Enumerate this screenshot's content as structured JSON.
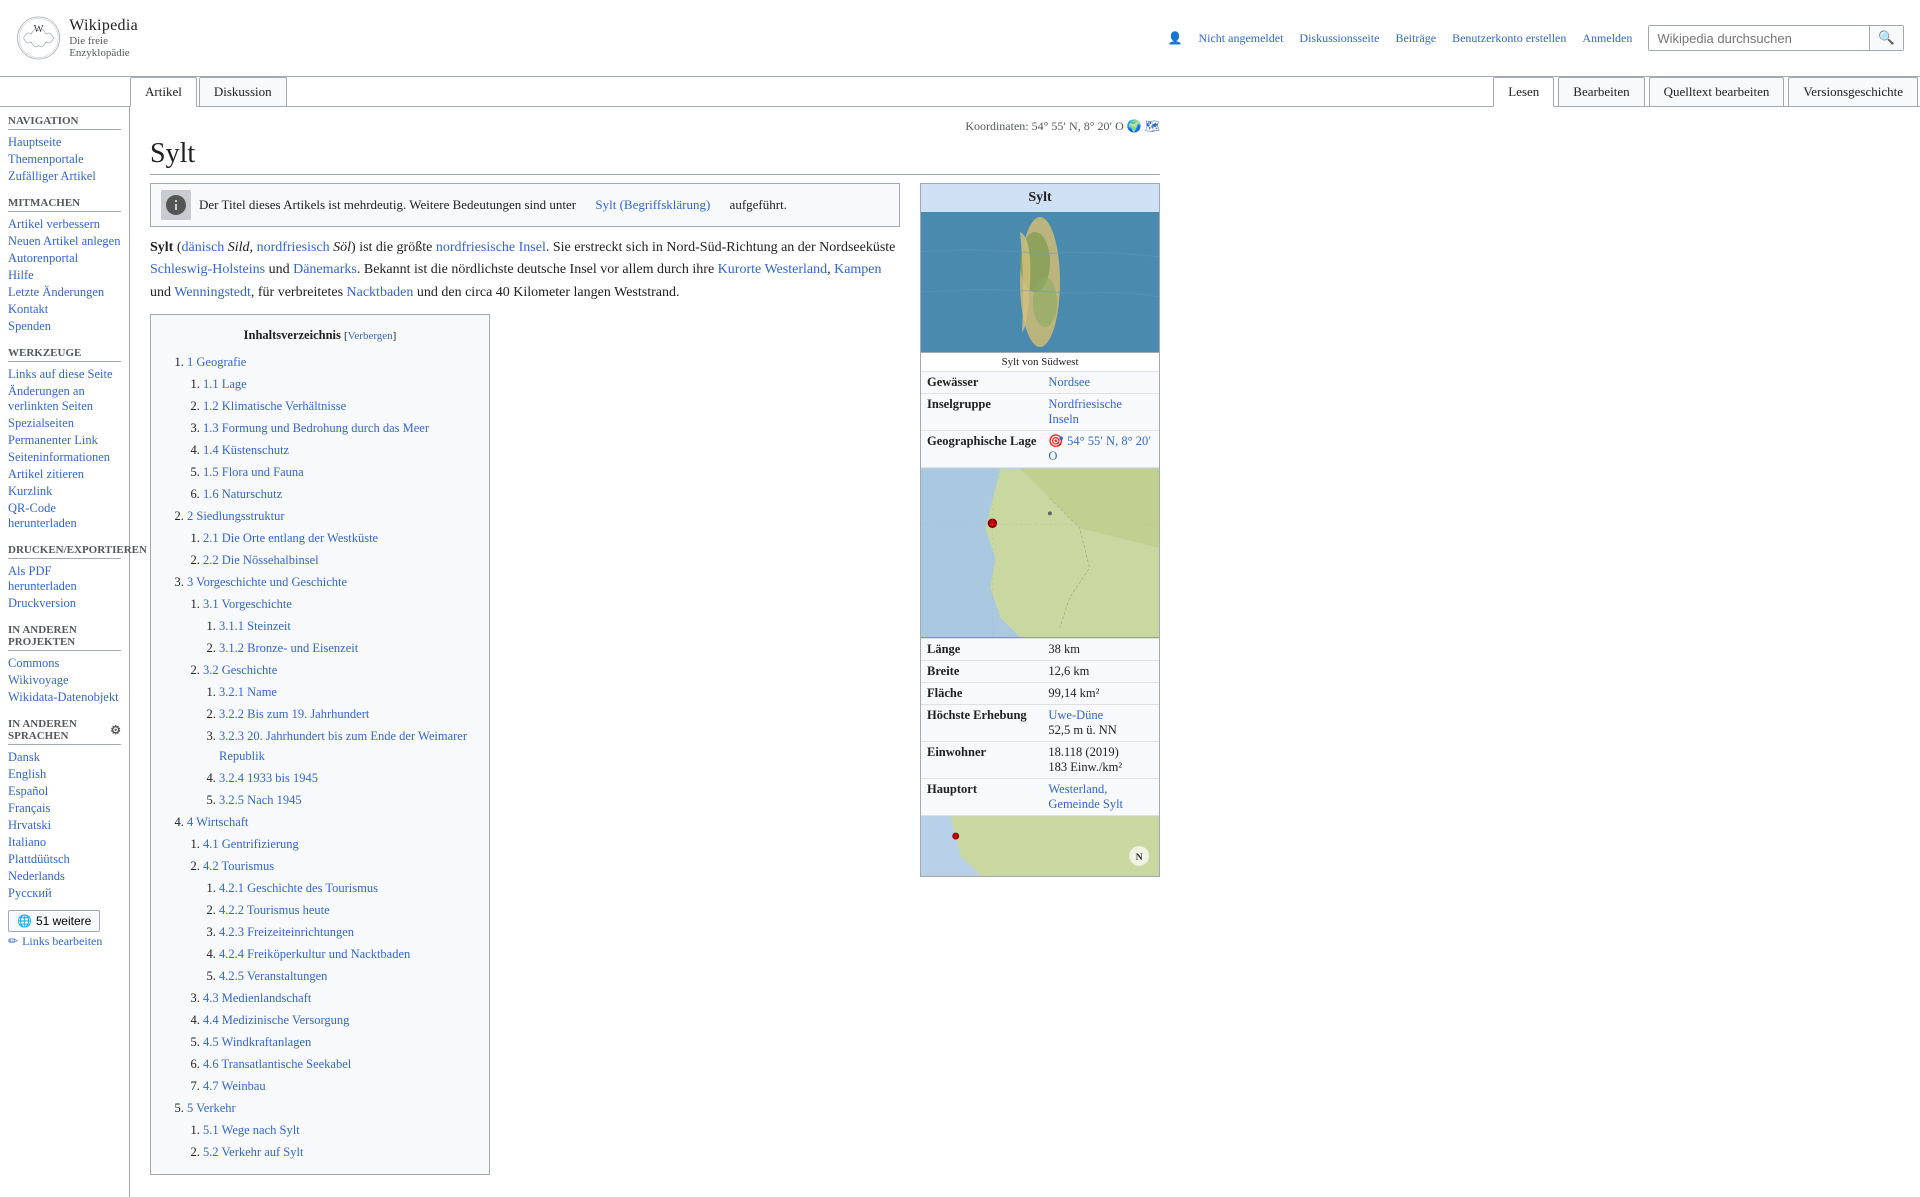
{
  "header": {
    "logo_title": "Wikipedia",
    "logo_subtitle": "Die freie Enzyklopädie",
    "top_nav": {
      "not_logged_in": "Nicht angemeldet",
      "discussion": "Diskussionsseite",
      "contributions": "Beiträge",
      "create_account": "Benutzerkonto erstellen",
      "login": "Anmelden"
    },
    "search_placeholder": "Wikipedia durchsuchen"
  },
  "tabs": {
    "article": "Artikel",
    "discussion": "Diskussion",
    "read": "Lesen",
    "edit": "Bearbeiten",
    "edit_source": "Quelltext bearbeiten",
    "history": "Versionsgeschichte"
  },
  "sidebar": {
    "navigation_title": "Navigation",
    "navigation_items": [
      {
        "label": "Hauptseite",
        "href": "#"
      },
      {
        "label": "Themenportale",
        "href": "#"
      },
      {
        "label": "Zufälliger Artikel",
        "href": "#"
      }
    ],
    "participate_title": "Mitmachen",
    "participate_items": [
      {
        "label": "Artikel verbessern",
        "href": "#"
      },
      {
        "label": "Neuen Artikel anlegen",
        "href": "#"
      },
      {
        "label": "Autorenportal",
        "href": "#"
      },
      {
        "label": "Hilfe",
        "href": "#"
      },
      {
        "label": "Letzte Änderungen",
        "href": "#"
      },
      {
        "label": "Kontakt",
        "href": "#"
      },
      {
        "label": "Spenden",
        "href": "#"
      }
    ],
    "tools_title": "Werkzeuge",
    "tools_items": [
      {
        "label": "Links auf diese Seite",
        "href": "#"
      },
      {
        "label": "Änderungen an verlinkten Seiten",
        "href": "#"
      },
      {
        "label": "Spezialseiten",
        "href": "#"
      },
      {
        "label": "Permanenter Link",
        "href": "#"
      },
      {
        "label": "Seiteninformationen",
        "href": "#"
      },
      {
        "label": "Artikel zitieren",
        "href": "#"
      },
      {
        "label": "Kurzlink",
        "href": "#"
      },
      {
        "label": "QR-Code herunterladen",
        "href": "#"
      }
    ],
    "print_title": "Drucken/exportieren",
    "print_items": [
      {
        "label": "Als PDF herunterladen",
        "href": "#"
      },
      {
        "label": "Druckversion",
        "href": "#"
      }
    ],
    "other_projects_title": "In anderen Projekten",
    "other_projects_items": [
      {
        "label": "Commons",
        "href": "#"
      },
      {
        "label": "Wikivoyage",
        "href": "#"
      },
      {
        "label": "Wikidata-Datenobjekt",
        "href": "#"
      }
    ],
    "languages_title": "In anderen Sprachen",
    "languages": [
      {
        "label": "Dansk",
        "href": "#"
      },
      {
        "label": "English",
        "href": "#"
      },
      {
        "label": "Español",
        "href": "#"
      },
      {
        "label": "Français",
        "href": "#"
      },
      {
        "label": "Hrvatski",
        "href": "#"
      },
      {
        "label": "Italiano",
        "href": "#"
      },
      {
        "label": "Plattdüütsch",
        "href": "#"
      },
      {
        "label": "Nederlands",
        "href": "#"
      },
      {
        "label": "Русский",
        "href": "#"
      }
    ],
    "more_langs_label": "51 weitere",
    "edit_links_label": "Links bearbeiten"
  },
  "page": {
    "title": "Sylt",
    "coords": "Koordinaten: 54° 55′ N, 8° 20′ O",
    "disambig_text": "Der Titel dieses Artikels ist mehrdeutig. Weitere Bedeutungen sind unter",
    "disambig_link": "Sylt (Begriffsklärung)",
    "disambig_suffix": "aufgeführt.",
    "intro": "Sylt (dänisch Sild, nordfriesisch Söl) ist die größte nordfriesische Insel. Sie erstreckt sich in Nord-Süd-Richtung an der Nordseeküste Schleswig-Holsteins und Dänemarks. Bekannt ist die nördlichste deutsche Insel vor allem durch ihre Kurorte Westerland, Kampen und Wenningstedt, für verbreitetes Nacktbaden und den circa 40 Kilometer langen Weststrand."
  },
  "toc": {
    "title": "Inhaltsverzeichnis",
    "hide_label": "Verbergen",
    "items": [
      {
        "num": "1",
        "label": "Geografie",
        "href": "#",
        "sub": [
          {
            "num": "1.1",
            "label": "Lage",
            "href": "#"
          },
          {
            "num": "1.2",
            "label": "Klimatische Verhältnisse",
            "href": "#"
          },
          {
            "num": "1.3",
            "label": "Formung und Bedrohung durch das Meer",
            "href": "#"
          },
          {
            "num": "1.4",
            "label": "Küstenschutz",
            "href": "#"
          },
          {
            "num": "1.5",
            "label": "Flora und Fauna",
            "href": "#"
          },
          {
            "num": "1.6",
            "label": "Naturschutz",
            "href": "#"
          }
        ]
      },
      {
        "num": "2",
        "label": "Siedlungsstruktur",
        "href": "#",
        "sub": [
          {
            "num": "2.1",
            "label": "Die Orte entlang der Westküste",
            "href": "#"
          },
          {
            "num": "2.2",
            "label": "Die Nössehalbinsel",
            "href": "#"
          }
        ]
      },
      {
        "num": "3",
        "label": "Vorgeschichte und Geschichte",
        "href": "#",
        "sub": [
          {
            "num": "3.1",
            "label": "Vorgeschichte",
            "href": "#",
            "sub2": [
              {
                "num": "3.1.1",
                "label": "Steinzeit",
                "href": "#"
              },
              {
                "num": "3.1.2",
                "label": "Bronze- und Eisenzeit",
                "href": "#"
              }
            ]
          },
          {
            "num": "3.2",
            "label": "Geschichte",
            "href": "#",
            "sub2": [
              {
                "num": "3.2.1",
                "label": "Name",
                "href": "#"
              },
              {
                "num": "3.2.2",
                "label": "Bis zum 19. Jahrhundert",
                "href": "#"
              },
              {
                "num": "3.2.3",
                "label": "20. Jahrhundert bis zum Ende der Weimarer Republik",
                "href": "#"
              },
              {
                "num": "3.2.4",
                "label": "1933 bis 1945",
                "href": "#"
              },
              {
                "num": "3.2.5",
                "label": "Nach 1945",
                "href": "#"
              }
            ]
          }
        ]
      },
      {
        "num": "4",
        "label": "Wirtschaft",
        "href": "#",
        "sub": [
          {
            "num": "4.1",
            "label": "Gentrifizierung",
            "href": "#"
          },
          {
            "num": "4.2",
            "label": "Tourismus",
            "href": "#",
            "sub2": [
              {
                "num": "4.2.1",
                "label": "Geschichte des Tourismus",
                "href": "#"
              },
              {
                "num": "4.2.2",
                "label": "Tourismus heute",
                "href": "#"
              },
              {
                "num": "4.2.3",
                "label": "Freizeiteinrichtungen",
                "href": "#"
              },
              {
                "num": "4.2.4",
                "label": "Freiköperkultur und Nacktbaden",
                "href": "#"
              },
              {
                "num": "4.2.5",
                "label": "Veranstaltungen",
                "href": "#"
              }
            ]
          },
          {
            "num": "4.3",
            "label": "Medienlandschaft",
            "href": "#"
          },
          {
            "num": "4.4",
            "label": "Medizinische Versorgung",
            "href": "#"
          },
          {
            "num": "4.5",
            "label": "Windkraftanlagen",
            "href": "#"
          },
          {
            "num": "4.6",
            "label": "Transatlantische Seekabel",
            "href": "#"
          },
          {
            "num": "4.7",
            "label": "Weinbau",
            "href": "#"
          }
        ]
      },
      {
        "num": "5",
        "label": "Verkehr",
        "href": "#",
        "sub": [
          {
            "num": "5.1",
            "label": "Wege nach Sylt",
            "href": "#"
          },
          {
            "num": "5.2",
            "label": "Verkehr auf Sylt",
            "href": "#"
          }
        ]
      }
    ]
  },
  "infobox": {
    "title": "Sylt",
    "image_caption": "Sylt von Südwest",
    "rows": [
      {
        "label": "Gewässer",
        "value": "Nordsee"
      },
      {
        "label": "Inselgruppe",
        "value": "Nordfriesische Inseln"
      },
      {
        "label": "Geographische Lage",
        "value": "54° 55′ N, 8° 20′ O"
      },
      {
        "label": "Länge",
        "value": "38 km"
      },
      {
        "label": "Breite",
        "value": "12,6 km"
      },
      {
        "label": "Fläche",
        "value": "99,14 km²"
      },
      {
        "label": "Höchste Erhebung",
        "value": "Uwe-Düne",
        "value2": "52,5 m ü. NN"
      },
      {
        "label": "Einwohner",
        "value": "18.118 (2019)",
        "value2": "183 Einw./km²"
      },
      {
        "label": "Hauptort",
        "value": "Westerland, Gemeinde Sylt"
      }
    ]
  }
}
